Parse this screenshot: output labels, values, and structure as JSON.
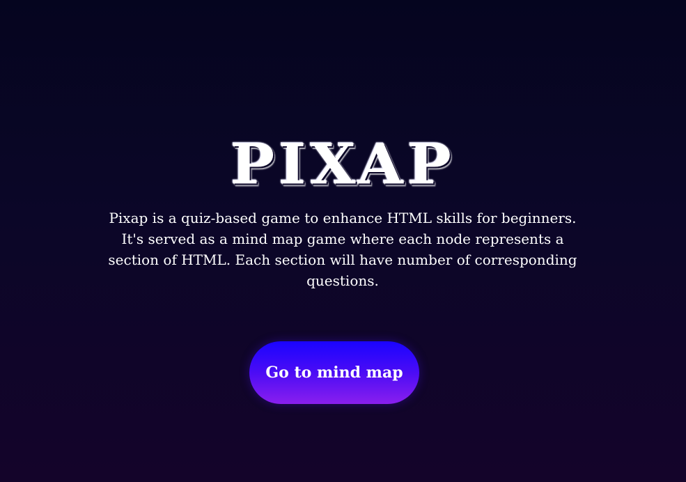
{
  "header": {
    "logo_text": "PIXAP"
  },
  "main": {
    "description": "Pixap is a quiz-based game to enhance HTML skills for beginners. It's served as a mind map game where each node represents a section of HTML. Each section will have number of corresponding questions.",
    "cta_label": "Go to mind map"
  },
  "colors": {
    "background_top": "#05051f",
    "background_bottom": "#14042a",
    "button_top": "#1a04ff",
    "button_bottom": "#8a1fee",
    "text": "#ffffff"
  }
}
